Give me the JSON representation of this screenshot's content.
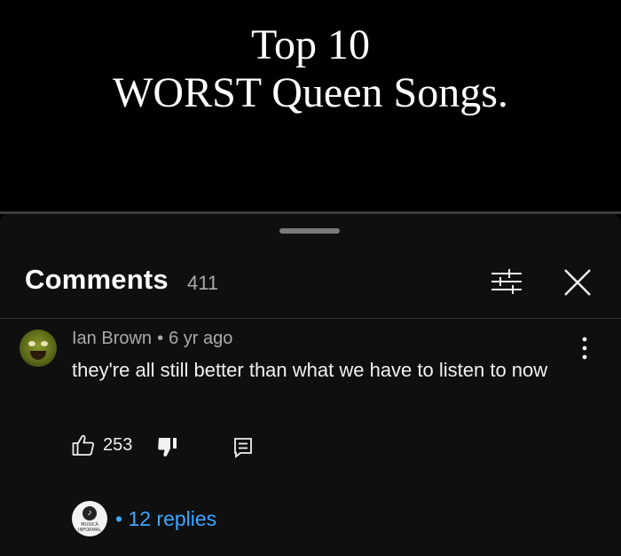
{
  "video": {
    "title_line1": "Top 10",
    "title_line2": "WORST Queen Songs."
  },
  "comments_panel": {
    "title": "Comments",
    "count": "411",
    "filter_icon": "filter-sliders-icon",
    "close_icon": "close-icon"
  },
  "comment": {
    "author": "Ian Brown",
    "separator": "•",
    "time": "6 yr ago",
    "text": "they're all still better than what we have to listen to now",
    "like_count": "253",
    "replies_separator": "•",
    "replies_label": "12 replies"
  },
  "reply_avatar": {
    "label": "MUSICA INFORMAL"
  },
  "colors": {
    "background": "#0f0f0f",
    "link": "#3ea6ff",
    "secondary_text": "#aaaaaa"
  }
}
